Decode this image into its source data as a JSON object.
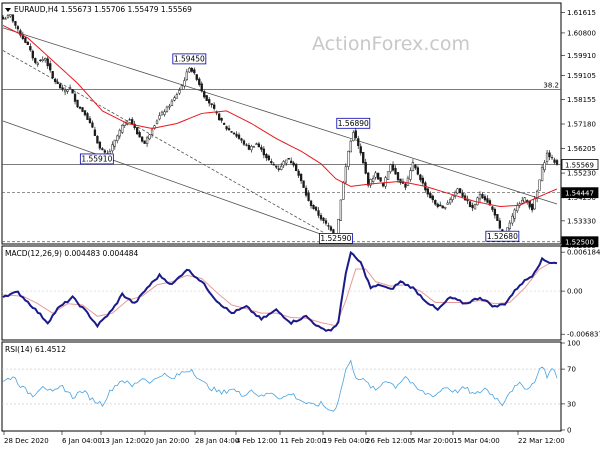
{
  "watermark": "ActionForex.com",
  "colors": {
    "candle": "#1a1a1a",
    "sma": "#e8191e",
    "channel": "#505050",
    "hline": "#505050",
    "label_border": "#0000aa",
    "macd": "#1a1a8a",
    "signal": "#e89a9a",
    "rsi": "#4aa3e0",
    "grid": "#c8c8c8"
  },
  "chart_data": [
    {
      "type": "candlestick",
      "panel": "price",
      "header": "EURAUD,H4  1.55673 1.55706 1.55479 1.55569",
      "symbol": "EURAUD,H4",
      "last_ohlc": {
        "open": 1.55673,
        "high": 1.55706,
        "low": 1.55479,
        "close": 1.55569
      },
      "y_ticks": [
        "1.61615",
        "1.60800",
        "1.59910",
        "1.59105",
        "1.58155",
        "1.57180",
        "1.56205",
        "1.55230",
        "1.54250",
        "1.53330",
        "1.52355"
      ],
      "ylim": [
        1.5245,
        1.6195
      ],
      "x_ticks": [
        "28 Dec 2020",
        "6 Jan 04:00",
        "13 Jan 12:00",
        "20 Jan 20:00",
        "28 Jan 04:00",
        "4 Feb 12:00",
        "11 Feb 20:00",
        "19 Feb 04:00",
        "26 Feb 12:00",
        "5 Mar 20:00",
        "15 Mar 04:00",
        "22 Mar 12:00"
      ],
      "price_path": [
        [
          0,
          1.6135
        ],
        [
          3,
          1.615
        ],
        [
          6,
          1.609
        ],
        [
          10,
          1.603
        ],
        [
          13,
          1.596
        ],
        [
          17,
          1.598
        ],
        [
          20,
          1.59
        ],
        [
          24,
          1.585
        ],
        [
          27,
          1.586
        ],
        [
          30,
          1.579
        ],
        [
          33,
          1.576
        ],
        [
          36,
          1.57
        ],
        [
          39,
          1.562
        ],
        [
          42,
          1.5591
        ],
        [
          45,
          1.565
        ],
        [
          48,
          1.571
        ],
        [
          51,
          1.574
        ],
        [
          54,
          1.568
        ],
        [
          57,
          1.564
        ],
        [
          60,
          1.57
        ],
        [
          63,
          1.575
        ],
        [
          66,
          1.578
        ],
        [
          69,
          1.582
        ],
        [
          72,
          1.587
        ],
        [
          75,
          1.5945
        ],
        [
          78,
          1.59
        ],
        [
          81,
          1.583
        ],
        [
          84,
          1.579
        ],
        [
          87,
          1.574
        ],
        [
          90,
          1.57
        ],
        [
          93,
          1.568
        ],
        [
          96,
          1.565
        ],
        [
          99,
          1.562
        ],
        [
          102,
          1.564
        ],
        [
          105,
          1.56
        ],
        [
          108,
          1.556
        ],
        [
          111,
          1.554
        ],
        [
          114,
          1.558
        ],
        [
          117,
          1.556
        ],
        [
          120,
          1.549
        ],
        [
          123,
          1.541
        ],
        [
          126,
          1.537
        ],
        [
          129,
          1.533
        ],
        [
          132,
          1.53
        ],
        [
          134,
          1.5259
        ],
        [
          136,
          1.542
        ],
        [
          139,
          1.561
        ],
        [
          141,
          1.5689
        ],
        [
          144,
          1.56
        ],
        [
          147,
          1.548
        ],
        [
          150,
          1.552
        ],
        [
          153,
          1.547
        ],
        [
          156,
          1.556
        ],
        [
          159,
          1.55
        ],
        [
          162,
          1.547
        ],
        [
          165,
          1.556
        ],
        [
          168,
          1.55
        ],
        [
          171,
          1.544
        ],
        [
          174,
          1.54
        ],
        [
          177,
          1.538
        ],
        [
          180,
          1.542
        ],
        [
          183,
          1.546
        ],
        [
          186,
          1.542
        ],
        [
          189,
          1.538
        ],
        [
          192,
          1.544
        ],
        [
          195,
          1.541
        ],
        [
          198,
          1.536
        ],
        [
          201,
          1.5268
        ],
        [
          204,
          1.532
        ],
        [
          207,
          1.54
        ],
        [
          210,
          1.542
        ],
        [
          213,
          1.538
        ],
        [
          215,
          1.545
        ],
        [
          217,
          1.554
        ],
        [
          219,
          1.56
        ],
        [
          221,
          1.558
        ],
        [
          223,
          1.5557
        ]
      ],
      "sma": [
        [
          0,
          1.611
        ],
        [
          10,
          1.606
        ],
        [
          20,
          1.597
        ],
        [
          30,
          1.588
        ],
        [
          40,
          1.577
        ],
        [
          50,
          1.572
        ],
        [
          60,
          1.57
        ],
        [
          70,
          1.572
        ],
        [
          80,
          1.576
        ],
        [
          90,
          1.577
        ],
        [
          100,
          1.572
        ],
        [
          110,
          1.566
        ],
        [
          120,
          1.561
        ],
        [
          128,
          1.556
        ],
        [
          134,
          1.55
        ],
        [
          140,
          1.547
        ],
        [
          148,
          1.548
        ],
        [
          160,
          1.549
        ],
        [
          170,
          1.547
        ],
        [
          180,
          1.544
        ],
        [
          190,
          1.541
        ],
        [
          200,
          1.539
        ],
        [
          208,
          1.5395
        ],
        [
          216,
          1.543
        ],
        [
          223,
          1.546
        ]
      ],
      "price_labels": [
        {
          "text": "1.59450",
          "x": 75,
          "y": 1.5945
        },
        {
          "text": "1.55910",
          "x": 42,
          "y": 1.5591
        },
        {
          "text": "1.56890",
          "x": 141,
          "y": 1.5689
        },
        {
          "text": "1.52590",
          "x": 134,
          "y": 1.5259
        },
        {
          "text": "1.52680",
          "x": 201,
          "y": 1.5268
        }
      ],
      "horizontal_levels": [
        {
          "value": 1.5855,
          "style": "solid",
          "label": "38.2"
        },
        {
          "value": 1.5557,
          "style": "solid"
        },
        {
          "value": 1.5445,
          "style": "dashed"
        },
        {
          "value": 1.525,
          "style": "dashed"
        }
      ],
      "axis_badges": [
        {
          "text": "1.55569",
          "value": 1.5557,
          "style": "outlined"
        },
        {
          "text": "1.54447",
          "value": 1.5445,
          "style": "filled"
        },
        {
          "text": "1.52500",
          "value": 1.525,
          "style": "filled"
        }
      ],
      "trendlines": [
        {
          "style": "solid",
          "from": [
            0,
            1.61
          ],
          "to": [
            223,
            1.54
          ]
        },
        {
          "style": "solid",
          "from": [
            0,
            1.573
          ],
          "to": [
            134,
            1.5259
          ]
        },
        {
          "style": "dashed",
          "from": [
            0,
            1.601
          ],
          "to": [
            134,
            1.5259
          ]
        }
      ]
    },
    {
      "type": "line",
      "panel": "macd",
      "header": "MACD(12,26,9) 0.004483 0.004484",
      "indicator": "MACD(12,26,9)",
      "last_values": {
        "macd": 0.004483,
        "signal": 0.004484
      },
      "y_ticks": [
        "0.006184",
        "0.00",
        "-0.006837"
      ],
      "ylim": [
        -0.0076,
        0.007
      ],
      "macd": [
        [
          0,
          -0.0008
        ],
        [
          6,
          -0.0002
        ],
        [
          12,
          -0.0025
        ],
        [
          18,
          -0.005
        ],
        [
          22,
          -0.0028
        ],
        [
          28,
          -0.001
        ],
        [
          34,
          -0.0035
        ],
        [
          38,
          -0.0055
        ],
        [
          44,
          -0.003
        ],
        [
          48,
          -0.0005
        ],
        [
          53,
          -0.002
        ],
        [
          58,
          0.0005
        ],
        [
          63,
          0.0025
        ],
        [
          68,
          0.001
        ],
        [
          74,
          0.0035
        ],
        [
          80,
          0.0015
        ],
        [
          86,
          -0.0015
        ],
        [
          92,
          -0.0035
        ],
        [
          98,
          -0.0025
        ],
        [
          104,
          -0.0045
        ],
        [
          110,
          -0.003
        ],
        [
          116,
          -0.005
        ],
        [
          122,
          -0.004
        ],
        [
          128,
          -0.006
        ],
        [
          132,
          -0.0062
        ],
        [
          135,
          -0.005
        ],
        [
          138,
          0.003
        ],
        [
          140,
          0.006
        ],
        [
          144,
          0.0045
        ],
        [
          148,
          0.0005
        ],
        [
          152,
          0.001
        ],
        [
          156,
          0.0002
        ],
        [
          160,
          0.0015
        ],
        [
          165,
          0.0005
        ],
        [
          170,
          -0.0015
        ],
        [
          175,
          -0.003
        ],
        [
          180,
          -0.001
        ],
        [
          186,
          -0.002
        ],
        [
          192,
          -0.001
        ],
        [
          198,
          -0.0025
        ],
        [
          202,
          -0.002
        ],
        [
          208,
          0.001
        ],
        [
          213,
          0.0025
        ],
        [
          217,
          0.005
        ],
        [
          220,
          0.0046
        ],
        [
          223,
          0.0045
        ]
      ],
      "signal": [
        [
          0,
          -0.0006
        ],
        [
          8,
          -0.0008
        ],
        [
          14,
          -0.002
        ],
        [
          20,
          -0.0035
        ],
        [
          26,
          -0.002
        ],
        [
          32,
          -0.0022
        ],
        [
          38,
          -0.004
        ],
        [
          44,
          -0.0035
        ],
        [
          50,
          -0.0015
        ],
        [
          56,
          -0.0008
        ],
        [
          62,
          0.001
        ],
        [
          68,
          0.0015
        ],
        [
          74,
          0.0025
        ],
        [
          80,
          0.002
        ],
        [
          86,
          -0.0002
        ],
        [
          92,
          -0.0022
        ],
        [
          98,
          -0.0028
        ],
        [
          104,
          -0.0035
        ],
        [
          110,
          -0.0035
        ],
        [
          116,
          -0.0042
        ],
        [
          122,
          -0.0043
        ],
        [
          128,
          -0.005
        ],
        [
          134,
          -0.0055
        ],
        [
          138,
          -0.0015
        ],
        [
          142,
          0.0035
        ],
        [
          146,
          0.0035
        ],
        [
          150,
          0.0015
        ],
        [
          156,
          0.0008
        ],
        [
          162,
          0.001
        ],
        [
          168,
          0.0
        ],
        [
          174,
          -0.0018
        ],
        [
          180,
          -0.0018
        ],
        [
          186,
          -0.0018
        ],
        [
          192,
          -0.0015
        ],
        [
          198,
          -0.002
        ],
        [
          204,
          -0.0018
        ],
        [
          210,
          0.0005
        ],
        [
          216,
          0.0035
        ],
        [
          220,
          0.0044
        ],
        [
          223,
          0.0045
        ]
      ]
    },
    {
      "type": "line",
      "panel": "rsi",
      "header": "RSI(14) 61.4512",
      "indicator": "RSI(14)",
      "last_value": 61.4512,
      "y_ticks": [
        "100",
        "70",
        "30",
        "0"
      ],
      "ylim": [
        0,
        100
      ],
      "levels": [
        70,
        30
      ],
      "rsi": [
        [
          0,
          55
        ],
        [
          4,
          62
        ],
        [
          8,
          48
        ],
        [
          12,
          40
        ],
        [
          16,
          52
        ],
        [
          20,
          42
        ],
        [
          24,
          50
        ],
        [
          28,
          38
        ],
        [
          32,
          45
        ],
        [
          36,
          35
        ],
        [
          40,
          30
        ],
        [
          44,
          48
        ],
        [
          48,
          58
        ],
        [
          52,
          50
        ],
        [
          56,
          60
        ],
        [
          60,
          55
        ],
        [
          64,
          65
        ],
        [
          68,
          58
        ],
        [
          72,
          66
        ],
        [
          76,
          70
        ],
        [
          80,
          55
        ],
        [
          84,
          48
        ],
        [
          88,
          42
        ],
        [
          92,
          48
        ],
        [
          96,
          40
        ],
        [
          100,
          46
        ],
        [
          104,
          38
        ],
        [
          108,
          44
        ],
        [
          112,
          36
        ],
        [
          116,
          42
        ],
        [
          120,
          34
        ],
        [
          124,
          28
        ],
        [
          128,
          30
        ],
        [
          132,
          22
        ],
        [
          134,
          26
        ],
        [
          136,
          45
        ],
        [
          138,
          70
        ],
        [
          140,
          78
        ],
        [
          142,
          62
        ],
        [
          146,
          55
        ],
        [
          150,
          45
        ],
        [
          154,
          58
        ],
        [
          158,
          50
        ],
        [
          162,
          62
        ],
        [
          166,
          48
        ],
        [
          170,
          42
        ],
        [
          174,
          40
        ],
        [
          178,
          50
        ],
        [
          182,
          44
        ],
        [
          186,
          48
        ],
        [
          190,
          40
        ],
        [
          194,
          48
        ],
        [
          198,
          38
        ],
        [
          201,
          30
        ],
        [
          204,
          45
        ],
        [
          208,
          52
        ],
        [
          212,
          48
        ],
        [
          215,
          62
        ],
        [
          217,
          75
        ],
        [
          219,
          62
        ],
        [
          221,
          70
        ],
        [
          223,
          61.45
        ]
      ]
    }
  ]
}
